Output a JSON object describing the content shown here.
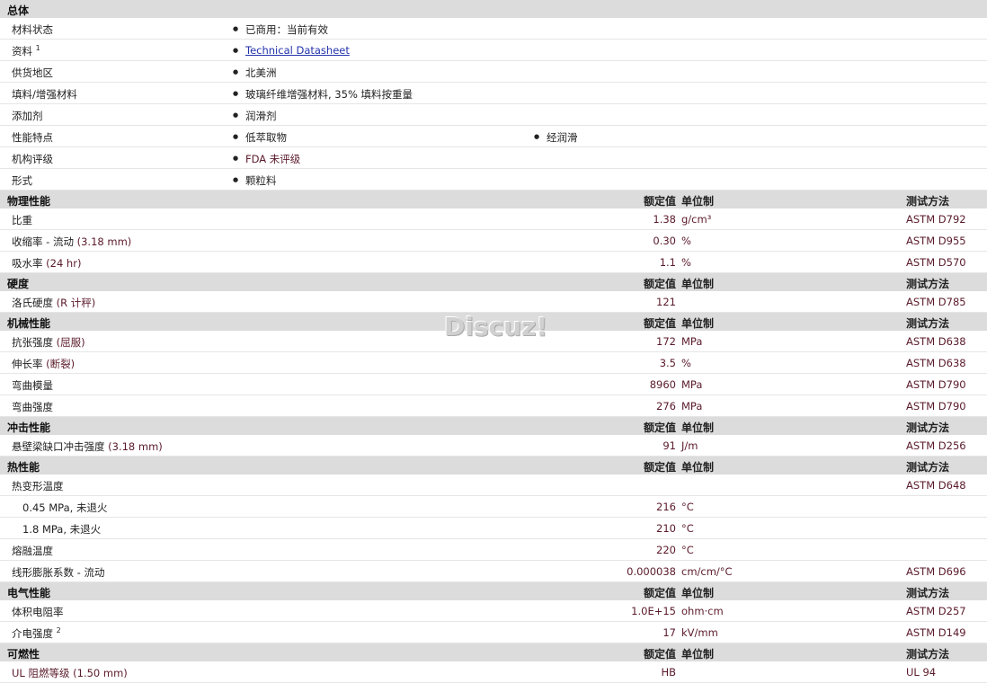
{
  "general": {
    "title": "总体",
    "rows": [
      {
        "label": "材料状态",
        "values": [
          "已商用：当前有效"
        ]
      },
      {
        "label": "资料",
        "sup": "1",
        "values": [
          "Technical Datasheet"
        ],
        "link": true
      },
      {
        "label": "供货地区",
        "values": [
          "北美洲"
        ]
      },
      {
        "label": "填料/增强材料",
        "values": [
          "玻璃纤维增强材料, 35% 填料按重量"
        ]
      },
      {
        "label": "添加剂",
        "values": [
          "润滑剂"
        ]
      },
      {
        "label": "性能特点",
        "values": [
          "低萃取物",
          "经润滑"
        ]
      },
      {
        "label": "机构评级",
        "values": [
          "FDA 未评级"
        ],
        "marked": true
      },
      {
        "label": "形式",
        "values": [
          "颗粒料"
        ]
      }
    ]
  },
  "header_labels": {
    "value": "额定值",
    "unit": "单位制",
    "method": "测试方法"
  },
  "sections": [
    {
      "title": "物理性能",
      "show_header": true,
      "rows": [
        {
          "label": "比重",
          "cond": "",
          "value": "1.38",
          "unit": "g/cm³",
          "method": "ASTM D792"
        },
        {
          "label": "收缩率 - 流动",
          "cond": "(3.18 mm)",
          "value": "0.30",
          "unit": "%",
          "method": "ASTM D955"
        },
        {
          "label": "吸水率",
          "cond": "(24 hr)",
          "value": "1.1",
          "unit": "%",
          "method": "ASTM D570"
        }
      ]
    },
    {
      "title": "硬度",
      "show_header": true,
      "rows": [
        {
          "label": "洛氏硬度",
          "cond": "(R 计秤)",
          "value": "121",
          "unit": "",
          "method": "ASTM D785"
        }
      ]
    },
    {
      "title": "机械性能",
      "show_header": true,
      "rows": [
        {
          "label": "抗张强度",
          "cond": "(屈服)",
          "value": "172",
          "unit": "MPa",
          "method": "ASTM D638"
        },
        {
          "label": "伸长率",
          "cond": "(断裂)",
          "value": "3.5",
          "unit": "%",
          "method": "ASTM D638"
        },
        {
          "label": "弯曲模量",
          "cond": "",
          "value": "8960",
          "unit": "MPa",
          "method": "ASTM D790"
        },
        {
          "label": "弯曲强度",
          "cond": "",
          "value": "276",
          "unit": "MPa",
          "method": "ASTM D790"
        }
      ]
    },
    {
      "title": "冲击性能",
      "show_header": true,
      "rows": [
        {
          "label": "悬壁梁缺口冲击强度",
          "cond": "(3.18 mm)",
          "value": "91",
          "unit": "J/m",
          "method": "ASTM D256"
        }
      ]
    },
    {
      "title": "热性能",
      "show_header": true,
      "rows": [
        {
          "label": "热变形温度",
          "cond": "",
          "value": "",
          "unit": "",
          "method": "ASTM D648"
        },
        {
          "label": "0.45 MPa, 未退火",
          "sub": true,
          "cond": "",
          "value": "216",
          "unit": "°C",
          "method": ""
        },
        {
          "label": "1.8 MPa, 未退火",
          "sub": true,
          "cond": "",
          "value": "210",
          "unit": "°C",
          "method": ""
        },
        {
          "label": "熔融温度",
          "cond": "",
          "value": "220",
          "unit": "°C",
          "method": ""
        },
        {
          "label": "线形膨胀系数 - 流动",
          "cond": "",
          "value": "0.000038",
          "unit": "cm/cm/°C",
          "method": "ASTM D696"
        }
      ]
    },
    {
      "title": "电气性能",
      "show_header": true,
      "rows": [
        {
          "label": "体积电阻率",
          "cond": "",
          "value": "1.0E+15",
          "unit": "ohm·cm",
          "method": "ASTM D257"
        },
        {
          "label": "介电强度",
          "sup": "2",
          "cond": "",
          "value": "17",
          "unit": "kV/mm",
          "method": "ASTM D149"
        }
      ]
    },
    {
      "title": "可燃性",
      "show_header": true,
      "rows": [
        {
          "label": "UL 阻燃等级",
          "cond": "(1.50 mm)",
          "value": "HB",
          "unit": "",
          "method": "UL 94",
          "marked": true
        }
      ]
    }
  ],
  "watermark": "Discuz!"
}
